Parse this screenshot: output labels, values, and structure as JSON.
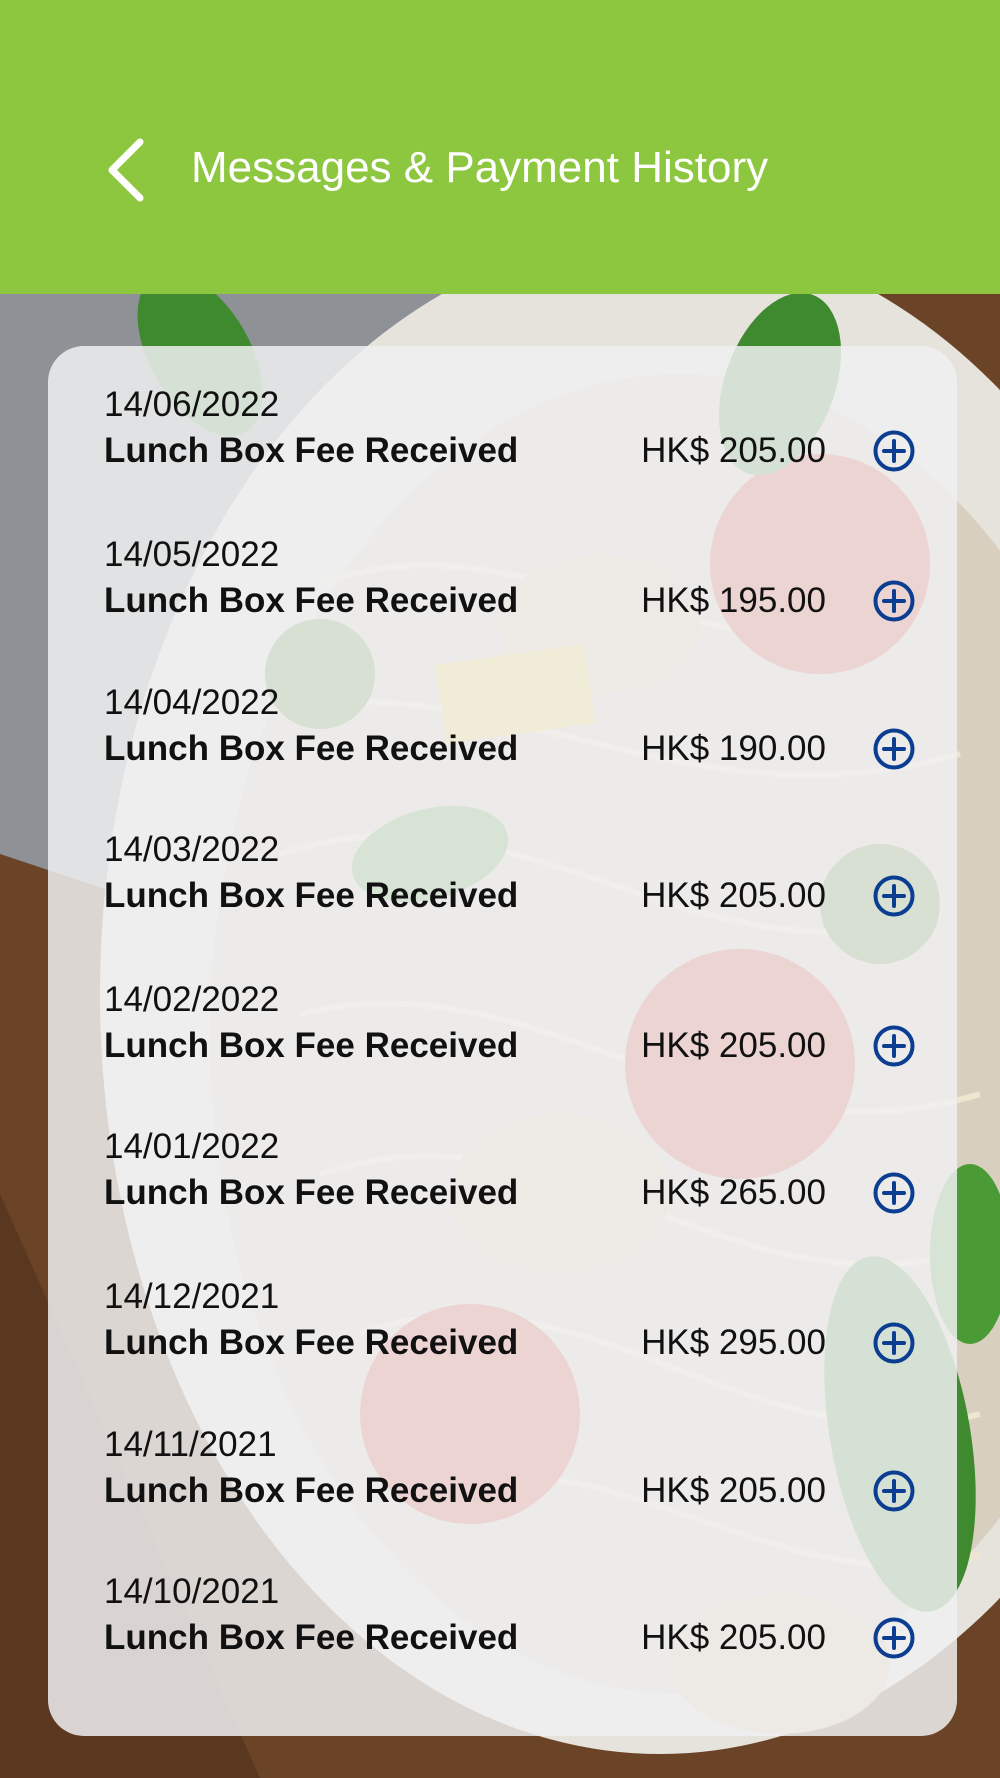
{
  "header": {
    "title": "Messages & Payment History",
    "back_icon": "chevron-left-icon",
    "background_color": "#8dc63f"
  },
  "colors": {
    "accent_icon": "#0b3d91",
    "text": "#111111"
  },
  "payments": [
    {
      "date": "14/06/2022",
      "description": "Lunch Box Fee Received",
      "amount": "HK$ 205.00",
      "icon": "plus-circle-icon"
    },
    {
      "date": "14/05/2022",
      "description": "Lunch Box Fee Received",
      "amount": "HK$ 195.00",
      "icon": "plus-circle-icon"
    },
    {
      "date": "14/04/2022",
      "description": "Lunch Box Fee Received",
      "amount": "HK$ 190.00",
      "icon": "plus-circle-icon"
    },
    {
      "date": "14/03/2022",
      "description": "Lunch Box Fee Received",
      "amount": "HK$ 205.00",
      "icon": "plus-circle-icon"
    },
    {
      "date": "14/02/2022",
      "description": "Lunch Box Fee Received",
      "amount": "HK$ 205.00",
      "icon": "plus-circle-icon"
    },
    {
      "date": "14/01/2022",
      "description": "Lunch Box Fee Received",
      "amount": "HK$ 265.00",
      "icon": "plus-circle-icon"
    },
    {
      "date": "14/12/2021",
      "description": "Lunch Box Fee Received",
      "amount": "HK$ 295.00",
      "icon": "plus-circle-icon"
    },
    {
      "date": "14/11/2021",
      "description": "Lunch Box Fee Received",
      "amount": "HK$ 205.00",
      "icon": "plus-circle-icon"
    },
    {
      "date": "14/10/2021",
      "description": "Lunch Box Fee Received",
      "amount": "HK$ 205.00",
      "icon": "plus-circle-icon"
    }
  ]
}
